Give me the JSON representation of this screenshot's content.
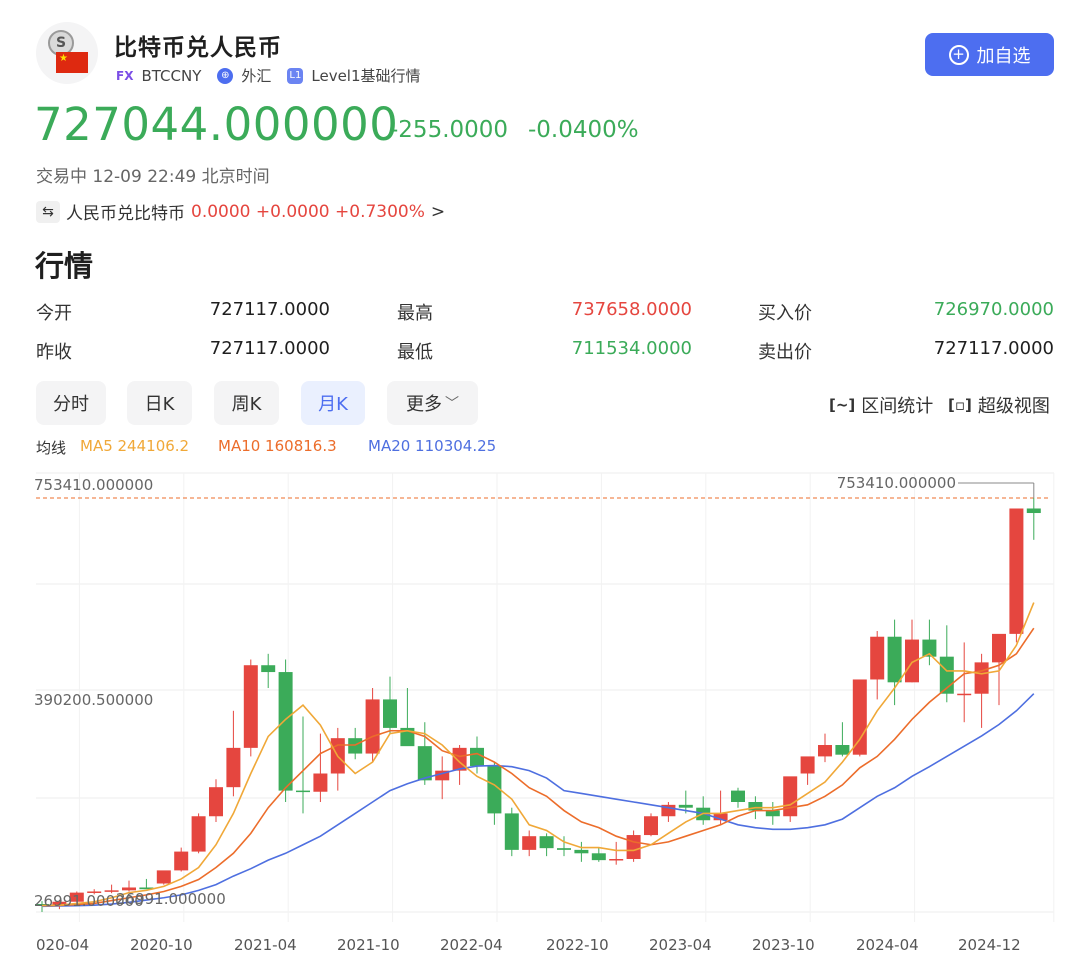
{
  "header": {
    "title": "比特币兑人民币",
    "fx_tag": "FX",
    "code": "BTCCNY",
    "market": "外汇",
    "level_badge": "L1",
    "level": "Level1基础行情",
    "add_button": "加自选",
    "coin_glyph": "S"
  },
  "quote": {
    "price": "727044.000000",
    "change": "-255.0000",
    "change_pct": "-0.0400%",
    "status": "交易中 12-09 22:49 北京时间",
    "reverse_label": "人民币兑比特币",
    "reverse_values": "0.0000 +0.0000 +0.7300%",
    "reverse_chevron": ">"
  },
  "market": {
    "section_title": "行情",
    "rows": [
      [
        {
          "label": "今开",
          "value": "727117.0000"
        },
        {
          "label": "最高",
          "value": "737658.0000"
        },
        {
          "label": "买入价",
          "value": "726970.0000"
        }
      ],
      [
        {
          "label": "昨收",
          "value": "727117.0000"
        },
        {
          "label": "最低",
          "value": "711534.0000"
        },
        {
          "label": "卖出价",
          "value": "727117.0000"
        }
      ]
    ]
  },
  "tabs": [
    "分时",
    "日K",
    "周K",
    "月K",
    "更多"
  ],
  "active_tab": "月K",
  "tools": {
    "range_stats": "区间统计",
    "super_view": "超级视图"
  },
  "ma_legend": {
    "label": "均线",
    "ma5": "MA5 244106.2",
    "ma10": "MA10 160816.3",
    "ma20": "MA20 110304.25"
  },
  "colors": {
    "up": "#e5463f",
    "down": "#3bab59",
    "accent": "#4d6ef0",
    "ma5": "#f0a838",
    "ma10": "#ec6d2b",
    "ma20": "#4e6fe0"
  },
  "chart_data": {
    "type": "candlestick",
    "y_labels": [
      "753410.000000",
      "390200.500000",
      "26991.000000"
    ],
    "ylim": [
      26991,
      753410
    ],
    "max_marker": "753410.000000",
    "min_marker": "26991.000000",
    "x_tick_labels": [
      "020-04",
      "2020-10",
      "2021-04",
      "2021-10",
      "2022-04",
      "2022-10",
      "2023-04",
      "2023-10",
      "2024-04",
      "2024-12"
    ],
    "x": [
      "2020-03",
      "2020-04",
      "2020-05",
      "2020-06",
      "2020-07",
      "2020-08",
      "2020-09",
      "2020-10",
      "2020-11",
      "2020-12",
      "2021-01",
      "2021-02",
      "2021-03",
      "2021-04",
      "2021-05",
      "2021-06",
      "2021-07",
      "2021-08",
      "2021-09",
      "2021-10",
      "2021-11",
      "2021-12",
      "2022-01",
      "2022-02",
      "2022-03",
      "2022-04",
      "2022-05",
      "2022-06",
      "2022-07",
      "2022-08",
      "2022-09",
      "2022-10",
      "2022-11",
      "2022-12",
      "2023-01",
      "2023-02",
      "2023-03",
      "2023-04",
      "2023-05",
      "2023-06",
      "2023-07",
      "2023-08",
      "2023-09",
      "2023-10",
      "2023-11",
      "2023-12",
      "2024-01",
      "2024-02",
      "2024-03",
      "2024-04",
      "2024-05",
      "2024-06",
      "2024-07",
      "2024-08",
      "2024-09",
      "2024-10",
      "2024-11",
      "2024-12"
    ],
    "open": [
      41000,
      38000,
      45000,
      61000,
      63000,
      65000,
      70000,
      77000,
      100000,
      133000,
      195000,
      246000,
      315000,
      460000,
      448000,
      240000,
      238000,
      270000,
      332000,
      305000,
      400000,
      350000,
      318000,
      258000,
      275000,
      315000,
      283000,
      200000,
      136000,
      160000,
      139000,
      136000,
      130000,
      118000,
      120000,
      162000,
      195000,
      215000,
      210000,
      188000,
      240000,
      220000,
      205000,
      195000,
      270000,
      300000,
      320000,
      303000,
      435000,
      510000,
      430000,
      505000,
      475000,
      410000,
      410000,
      465000,
      515000,
      735000
    ],
    "high": [
      46000,
      48000,
      63000,
      67000,
      75000,
      82000,
      85000,
      95000,
      140000,
      200000,
      260000,
      380000,
      470000,
      480000,
      470000,
      370000,
      340000,
      350000,
      350000,
      420000,
      440000,
      420000,
      360000,
      300000,
      320000,
      335000,
      290000,
      210000,
      170000,
      165000,
      160000,
      150000,
      140000,
      150000,
      170000,
      200000,
      220000,
      240000,
      230000,
      240000,
      245000,
      230000,
      220000,
      240000,
      290000,
      340000,
      360000,
      380000,
      520000,
      540000,
      540000,
      540000,
      530000,
      500000,
      480000,
      510000,
      730000,
      753410
    ],
    "low": [
      27000,
      32000,
      44000,
      58000,
      60000,
      63000,
      68000,
      75000,
      98000,
      130000,
      185000,
      230000,
      300000,
      420000,
      220000,
      200000,
      220000,
      240000,
      295000,
      290000,
      340000,
      320000,
      250000,
      225000,
      250000,
      270000,
      180000,
      125000,
      125000,
      125000,
      125000,
      115000,
      115000,
      110000,
      115000,
      160000,
      185000,
      200000,
      180000,
      180000,
      210000,
      190000,
      180000,
      185000,
      250000,
      290000,
      300000,
      300000,
      400000,
      390000,
      430000,
      460000,
      395000,
      360000,
      350000,
      390000,
      500000,
      680000
    ],
    "close": [
      38000,
      45000,
      61000,
      63000,
      65000,
      70000,
      67000,
      100000,
      133000,
      195000,
      246000,
      315000,
      460000,
      448000,
      240000,
      238000,
      270000,
      332000,
      305000,
      400000,
      350000,
      318000,
      258000,
      275000,
      315000,
      283000,
      200000,
      136000,
      160000,
      139000,
      136000,
      130000,
      118000,
      120000,
      162000,
      195000,
      215000,
      210000,
      188000,
      200000,
      220000,
      205000,
      195000,
      265000,
      300000,
      320000,
      303000,
      435000,
      510000,
      430000,
      505000,
      475000,
      410000,
      410000,
      465000,
      515000,
      735000,
      727044
    ],
    "ma5": [
      38000,
      39000,
      42000,
      45000,
      52000,
      61000,
      65000,
      72000,
      85000,
      105000,
      145000,
      200000,
      270000,
      335000,
      365000,
      390000,
      355000,
      300000,
      270000,
      290000,
      340000,
      345000,
      340000,
      320000,
      290000,
      265000,
      250000,
      225000,
      180000,
      170000,
      150000,
      140000,
      140000,
      135000,
      135000,
      145000,
      165000,
      185000,
      200000,
      200000,
      205000,
      210000,
      210000,
      215000,
      235000,
      255000,
      290000,
      330000,
      380000,
      420000,
      465000,
      480000,
      450000,
      450000,
      445000,
      450000,
      495000,
      570000
    ],
    "ma10": [
      38000,
      38500,
      40000,
      42000,
      47000,
      52000,
      57000,
      63000,
      72000,
      84000,
      105000,
      130000,
      165000,
      210000,
      245000,
      275000,
      305000,
      320000,
      320000,
      335000,
      345000,
      345000,
      335000,
      310000,
      300000,
      305000,
      290000,
      270000,
      245000,
      230000,
      205000,
      185000,
      175000,
      160000,
      150000,
      145000,
      150000,
      160000,
      170000,
      180000,
      195000,
      205000,
      205000,
      210000,
      215000,
      230000,
      250000,
      280000,
      300000,
      330000,
      365000,
      395000,
      420000,
      445000,
      450000,
      460000,
      480000,
      525000
    ],
    "ma20": [
      37000,
      37500,
      38000,
      39000,
      41000,
      44000,
      48000,
      52000,
      57000,
      65000,
      75000,
      90000,
      103000,
      118000,
      130000,
      145000,
      160000,
      180000,
      200000,
      220000,
      240000,
      252000,
      262000,
      270000,
      278000,
      283000,
      284000,
      282000,
      275000,
      262000,
      240000,
      235000,
      230000,
      225000,
      220000,
      215000,
      210000,
      205000,
      200000,
      190000,
      180000,
      175000,
      172000,
      172000,
      175000,
      180000,
      190000,
      210000,
      230000,
      245000,
      265000,
      282000,
      300000,
      318000,
      336000,
      356000,
      380000,
      410000
    ]
  }
}
